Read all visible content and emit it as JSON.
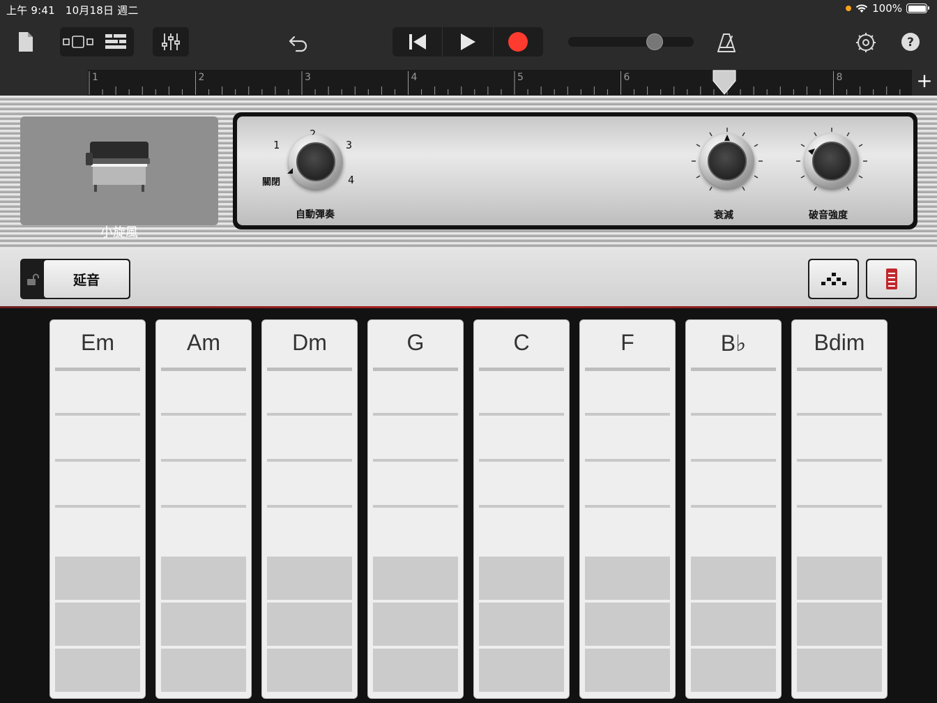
{
  "status_bar": {
    "time": "上午 9:41",
    "date": "10月18日 週二",
    "battery": "100%"
  },
  "toolbar": {
    "icons": [
      "document-icon",
      "track-view-icon",
      "tracks-list-icon",
      "mixer-icon",
      "undo-icon",
      "go-to-start-icon",
      "play-icon",
      "record-icon",
      "metronome-icon",
      "settings-icon",
      "help-icon"
    ],
    "record_color": "#ff3b30",
    "master_volume": 0.72
  },
  "ruler": {
    "bars": [
      "1",
      "2",
      "3",
      "4",
      "5",
      "6",
      "7",
      "8"
    ],
    "playhead_bar": 7,
    "add_label": "+"
  },
  "instrument": {
    "name": "小旋風"
  },
  "controls": {
    "autoplay": {
      "label": "自動彈奏",
      "off_label": "關閉",
      "positions": [
        "1",
        "2",
        "3",
        "4"
      ],
      "selected": "關閉"
    },
    "decay": {
      "label": "衰減"
    },
    "drive": {
      "label": "破音強度"
    }
  },
  "strip": {
    "sustain_label": "延音",
    "sustain_locked": false,
    "arpeggiator_icon": "arpeggiator-icon",
    "chord_strips_icon": "chord-strips-icon",
    "accent_color": "#c0282d"
  },
  "chords": [
    "Em",
    "Am",
    "Dm",
    "G",
    "C",
    "F",
    "B♭",
    "Bdim"
  ]
}
